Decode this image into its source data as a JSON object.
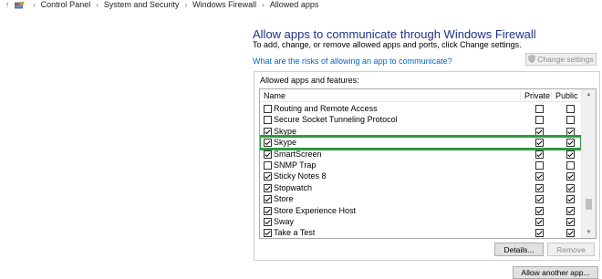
{
  "breadcrumb": {
    "items": [
      "Control Panel",
      "System and Security",
      "Windows Firewall",
      "Allowed apps"
    ],
    "separator": "›"
  },
  "header": {
    "title": "Allow apps to communicate through Windows Firewall",
    "instructions": "To add, change, or remove allowed apps and ports, click Change settings.",
    "risk_link": "What are the risks of allowing an app to communicate?",
    "change_settings_label": "Change settings"
  },
  "apps": {
    "group_label": "Allowed apps and features:",
    "columns": {
      "name": "Name",
      "private": "Private",
      "public": "Public"
    },
    "rows": [
      {
        "name": "Routing and Remote Access",
        "enabled": false,
        "private": false,
        "public": false
      },
      {
        "name": "Secure Socket Tunneling Protocol",
        "enabled": false,
        "private": false,
        "public": false
      },
      {
        "name": "Skype",
        "enabled": true,
        "private": true,
        "public": true
      },
      {
        "name": "Skype",
        "enabled": true,
        "private": true,
        "public": true,
        "highlighted": true
      },
      {
        "name": "SmartScreen",
        "enabled": true,
        "private": true,
        "public": true
      },
      {
        "name": "SNMP Trap",
        "enabled": false,
        "private": false,
        "public": false
      },
      {
        "name": "Sticky Notes 8",
        "enabled": true,
        "private": true,
        "public": true
      },
      {
        "name": "Stopwatch",
        "enabled": true,
        "private": true,
        "public": true
      },
      {
        "name": "Store",
        "enabled": true,
        "private": true,
        "public": true
      },
      {
        "name": "Store Experience Host",
        "enabled": true,
        "private": true,
        "public": true
      },
      {
        "name": "Sway",
        "enabled": true,
        "private": true,
        "public": true
      },
      {
        "name": "Take a Test",
        "enabled": true,
        "private": true,
        "public": true
      }
    ],
    "details_label": "Details...",
    "remove_label": "Remove"
  },
  "footer": {
    "allow_another_label": "Allow another app..."
  },
  "colors": {
    "title": "#1e3287",
    "link": "#0066cc",
    "highlight": "#2f9a3e"
  }
}
